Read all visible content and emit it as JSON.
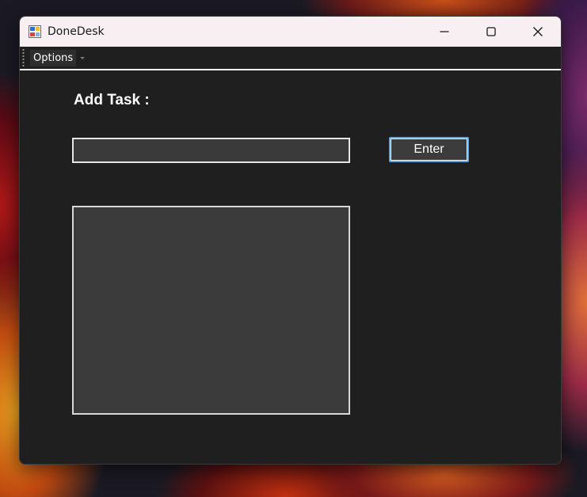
{
  "window": {
    "title": "DoneDesk",
    "icon": "winforms-app-icon",
    "controls": {
      "minimize": "minimize-icon",
      "maximize": "maximize-icon",
      "close": "close-icon"
    }
  },
  "menu": {
    "items": [
      {
        "label": "Options"
      }
    ]
  },
  "form": {
    "add_label": "Add Task :",
    "task_input": {
      "value": "",
      "placeholder": ""
    },
    "enter_button": "Enter",
    "task_list": {
      "items": []
    }
  },
  "colors": {
    "titlebar_bg": "#f7eff1",
    "window_bg": "#1f1f1f",
    "input_bg": "#3a3a3a",
    "button_focus_border": "#5fa8e8",
    "text": "#ffffff"
  }
}
